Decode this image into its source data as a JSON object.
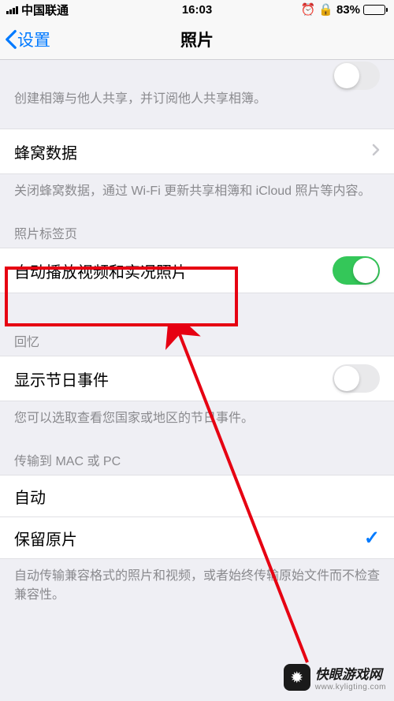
{
  "status": {
    "carrier": "中国联通",
    "time": "16:03",
    "battery_pct": "83%"
  },
  "nav": {
    "back_label": "设置",
    "title": "照片"
  },
  "shared_albums": {
    "footer": "创建相簿与他人共享，并订阅他人共享相簿。"
  },
  "cellular": {
    "label": "蜂窝数据",
    "footer": "关闭蜂窝数据，通过 Wi-Fi 更新共享相簿和 iCloud 照片等内容。"
  },
  "photos_tab": {
    "header": "照片标签页",
    "autoplay_label": "自动播放视频和实况照片",
    "autoplay_on": true
  },
  "memories": {
    "header": "回忆",
    "holiday_label": "显示节日事件",
    "holiday_on": false,
    "footer": "您可以选取查看您国家或地区的节日事件。"
  },
  "transfer": {
    "header": "传输到 MAC 或 PC",
    "auto_label": "自动",
    "keep_label": "保留原片",
    "selected": "keep",
    "footer": "自动传输兼容格式的照片和视频，或者始终传输原始文件而不检查兼容性。"
  },
  "watermark": {
    "brand": "快眼游戏网",
    "url": "www.kyligting.com"
  }
}
